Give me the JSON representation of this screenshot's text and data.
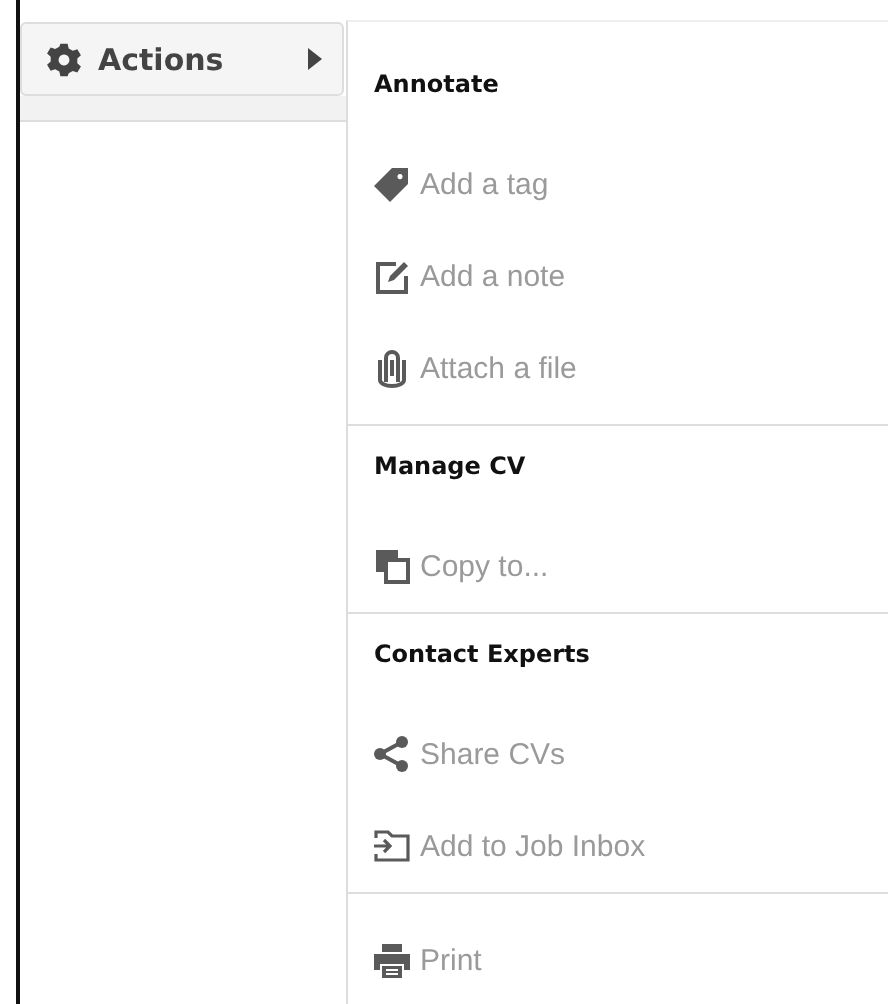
{
  "sidebar": {
    "button": {
      "label": "Actions",
      "expanded": true
    }
  },
  "menu": {
    "sections": [
      {
        "header": "Annotate",
        "items": [
          {
            "label": "Add a tag",
            "kind": "tag",
            "disabled": true
          },
          {
            "label": "Add a note",
            "kind": "note",
            "disabled": true
          },
          {
            "label": "Attach a file",
            "kind": "clip",
            "disabled": true
          }
        ]
      },
      {
        "header": "Manage CV",
        "items": [
          {
            "label": "Copy to...",
            "kind": "copy",
            "disabled": true
          }
        ]
      },
      {
        "header": "Contact Experts",
        "items": [
          {
            "label": "Share CVs",
            "kind": "share",
            "disabled": true
          },
          {
            "label": "Add to Job Inbox",
            "kind": "inbox",
            "disabled": true
          }
        ]
      },
      {
        "items": [
          {
            "label": "Print",
            "kind": "print",
            "disabled": true
          }
        ]
      }
    ]
  }
}
